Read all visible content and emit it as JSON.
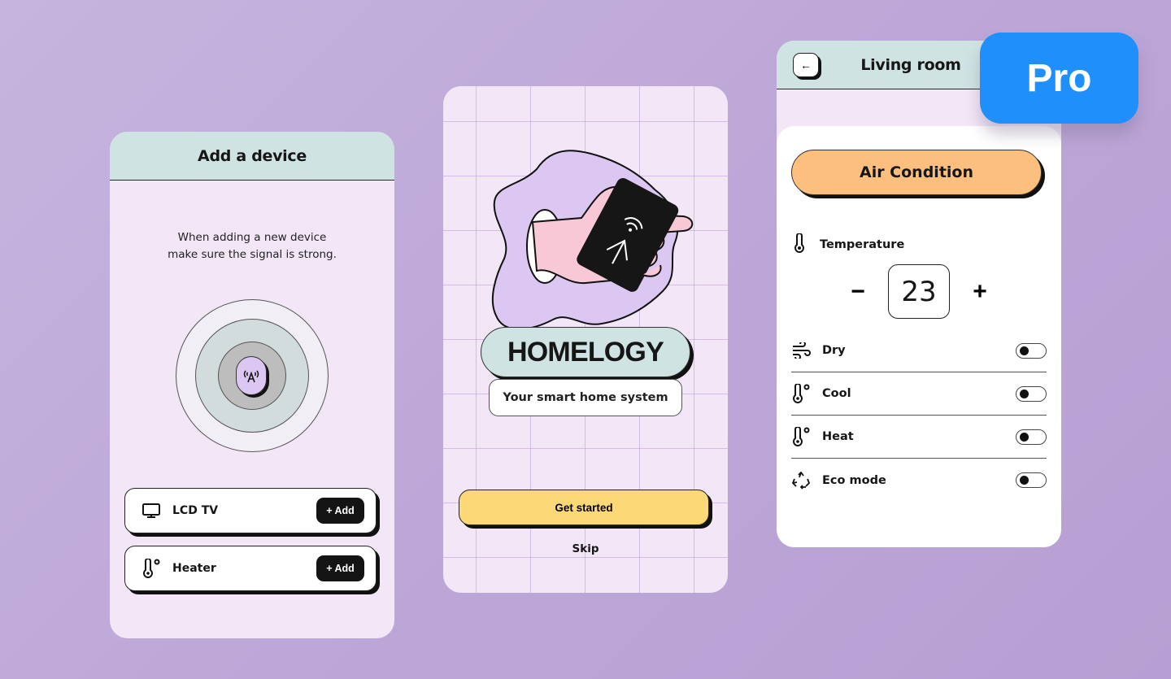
{
  "colors": {
    "background": "#c1acd9",
    "screen_bg": "#f2e6f7",
    "header_bg": "#cfe3e2",
    "cta_yellow": "#fdd877",
    "ac_orange": "#fdbf7d",
    "pro_blue": "#1f8ffb",
    "blob_lilac": "#dcc7f3"
  },
  "add_device_screen": {
    "title": "Add a device",
    "hint_line1": "When adding a new device",
    "hint_line2": "make sure the signal is strong.",
    "radar_icon": "antenna-icon",
    "radar_glyph": "(ᴬ)",
    "devices": [
      {
        "label": "LCD TV",
        "icon": "monitor-icon",
        "action": "+ Add"
      },
      {
        "label": "Heater",
        "icon": "thermometer-icon",
        "action": "+ Add"
      }
    ]
  },
  "welcome_screen": {
    "brand": "HOMELOGY",
    "tagline": "Your smart home system",
    "primary_action": "Get started",
    "secondary_action": "Skip",
    "illustration": "hand-holding-smart-card-illustration"
  },
  "living_room_screen": {
    "title": "Living room",
    "back_icon": "arrow-left-icon",
    "back_glyph": "←",
    "device": "Air Condition",
    "temperature": {
      "label": "Temperature",
      "value": "23",
      "decrement": "−",
      "increment": "+"
    },
    "modes": [
      {
        "label": "Dry",
        "icon": "wind-icon",
        "on": false
      },
      {
        "label": "Cool",
        "icon": "thermometer-degree-icon",
        "on": false
      },
      {
        "label": "Heat",
        "icon": "thermometer-degree-icon",
        "on": false
      },
      {
        "label": "Eco mode",
        "icon": "recycle-icon",
        "on": false
      }
    ]
  },
  "badge": {
    "label": "Pro"
  }
}
